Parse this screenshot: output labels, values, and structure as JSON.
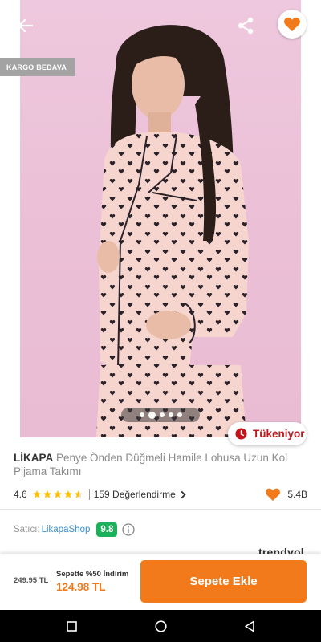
{
  "hero": {
    "badge_cargo": "KARGO BEDAVA",
    "stock_label": "Tükeniyor",
    "image_count": 5,
    "active_image": 2
  },
  "product": {
    "brand": "LİKAPA",
    "name": "Penye Önden Düğmeli Hamile Lohusa Uzun Kol Pijama Takımı",
    "rating": "4.6",
    "rating_value": 4.6,
    "review_text": "159 Değerlendirme",
    "favorite_count": "5.4B"
  },
  "seller": {
    "label": "Satıcı:",
    "name": "LikapaShop",
    "score": "9.8"
  },
  "peek": {
    "brand_logo_text": "trendyol"
  },
  "bottom": {
    "old_price": "249.95 TL",
    "promo_text": "Sepette %50 İndirim",
    "new_price": "124.98 TL",
    "add_button": "Sepete Ekle"
  },
  "colors": {
    "accent": "#f27a1a",
    "stock_red": "#c0161b",
    "seller_green": "#1cb05a",
    "link_blue": "#3d8ecb",
    "hero_bg": "#ebc2d8"
  },
  "icons": {
    "back": "arrow-left-icon",
    "share": "share-icon",
    "favorite": "heart-icon",
    "stock": "clock-icon",
    "info": "info-icon",
    "nav_recents": "square-icon",
    "nav_home": "circle-icon",
    "nav_back": "triangle-back-icon"
  }
}
